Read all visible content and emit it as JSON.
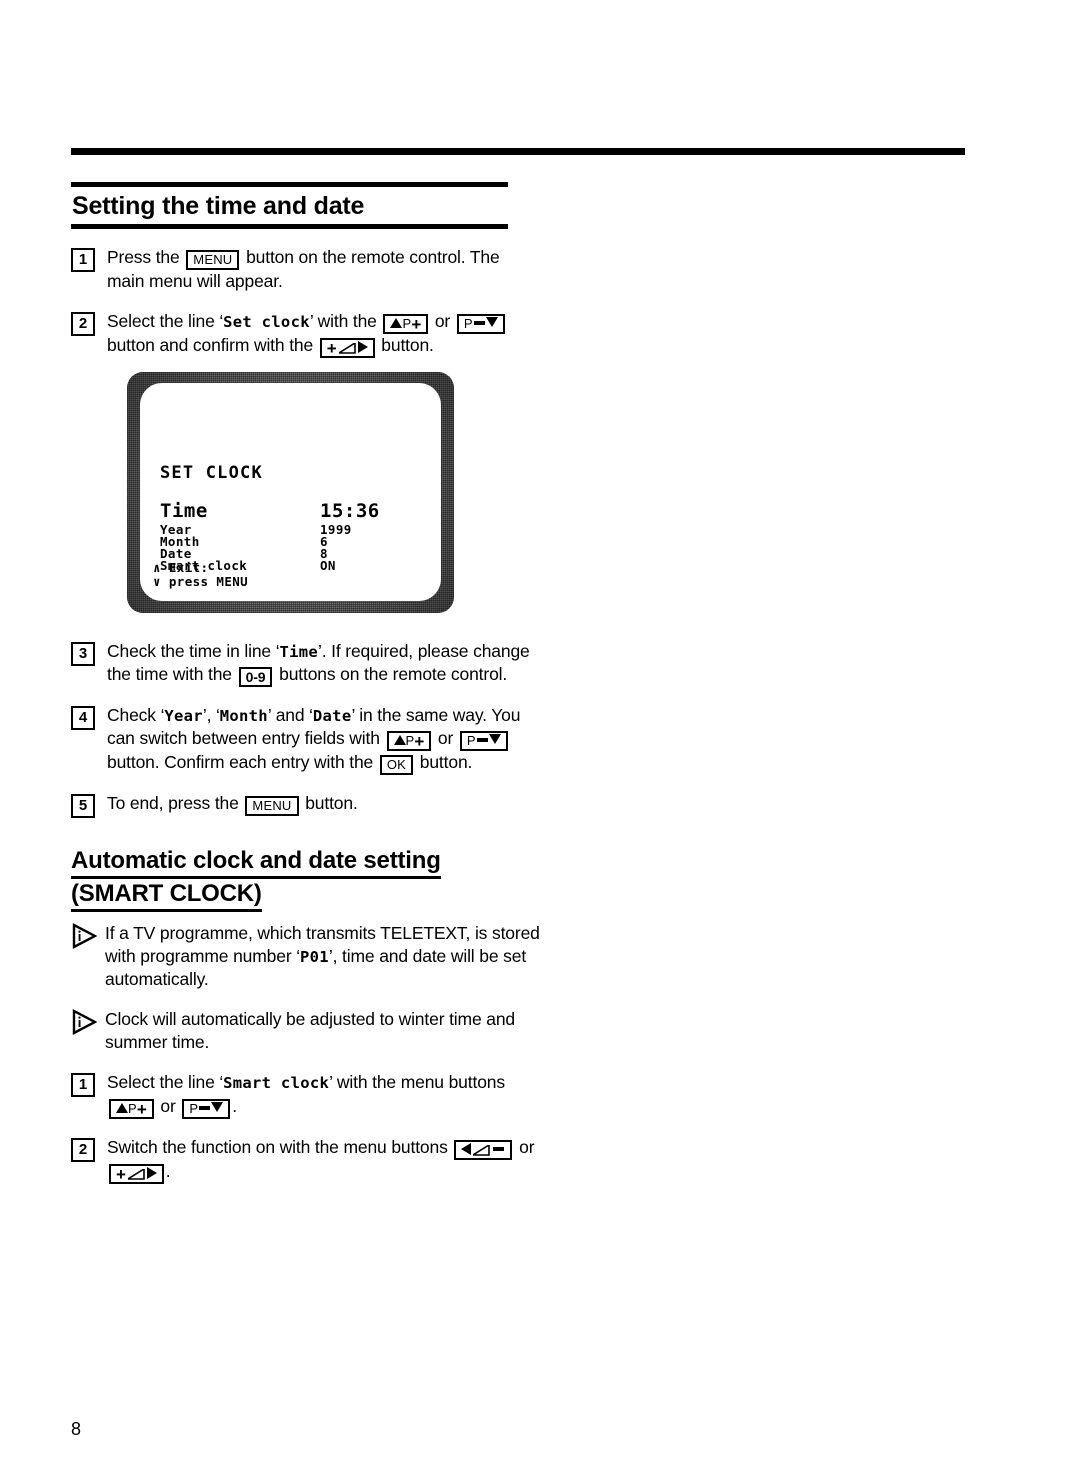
{
  "page": {
    "number": "8"
  },
  "headings": {
    "main": "Setting the time and date",
    "sub_line1": "Automatic clock and date setting",
    "sub_line2": "(SMART CLOCK)"
  },
  "keys": {
    "menu": "MENU",
    "ok": "OK",
    "digits": "0-9",
    "p_up": "P",
    "p_down": "P"
  },
  "steps_clock": [
    {
      "num": "1",
      "t1": "Press the",
      "t2": "button on the remote control. The main menu will appear."
    },
    {
      "num": "2",
      "t1": "Select the line ‘",
      "osd": "Set clock",
      "t2": "’ with the",
      "t3": "or",
      "t4": "button and confirm with the",
      "t5": "button."
    },
    {
      "num": "3",
      "t1": "Check the time in line ‘",
      "osd": "Time",
      "t2": "’. If required, please change the time with the",
      "t3": "buttons on the remote control."
    },
    {
      "num": "4",
      "t1": "Check ‘",
      "osd1": "Year",
      "t2": "’, ‘",
      "osd2": "Month",
      "t3": "’ and ‘",
      "osd3": "Date",
      "t4": "’ in the same way. You can switch between entry fields with",
      "t5": "or",
      "t6": "button. Confirm each entry with the",
      "t7": "button."
    },
    {
      "num": "5",
      "t1": "To end, press the",
      "t2": "button."
    }
  ],
  "notes": [
    {
      "t1": "If a TV programme, which transmits TELETEXT, is stored with programme number ‘",
      "osd": "P01",
      "t2": "’, time and date will be set automatically."
    },
    {
      "t1": "Clock will automatically be adjusted to winter time and summer time.",
      "osd": "",
      "t2": ""
    }
  ],
  "steps_smart": [
    {
      "num": "1",
      "t1": "Select the line ‘",
      "osd": "Smart clock",
      "t2": "’ with the menu buttons",
      "t3": "or",
      "t4": "."
    },
    {
      "num": "2",
      "t1": "Switch the function on with the menu buttons",
      "t2": "or",
      "t3": "."
    }
  ],
  "tv_osd": {
    "title": "SET CLOCK",
    "rows": [
      {
        "label": "Time",
        "value": "15:36",
        "big": true
      },
      {
        "label": "Year",
        "value": "1999",
        "big": false
      },
      {
        "label": "Month",
        "value": "6",
        "big": false
      },
      {
        "label": "Date",
        "value": "8",
        "big": false
      },
      {
        "label": "Smart clock",
        "value": "ON",
        "big": false
      }
    ],
    "footer_line1": "∧ Exit:",
    "footer_line2": "∨ press MENU"
  }
}
